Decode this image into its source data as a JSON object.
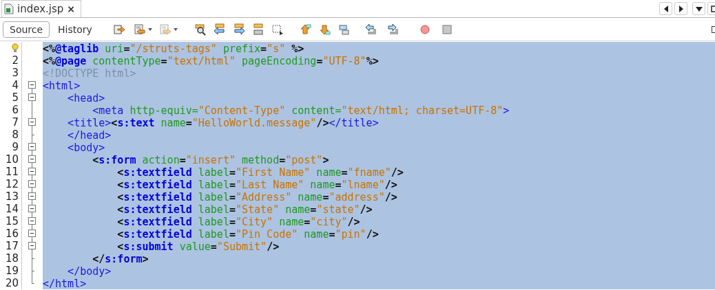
{
  "tab": {
    "title": "index.jsp",
    "close": "×",
    "selected": true
  },
  "view_tabs": [
    {
      "label": "Source",
      "selected": true
    },
    {
      "label": "History",
      "selected": false
    }
  ],
  "editor": {
    "selected": true,
    "lines": [
      {
        "hint": true,
        "kind": "plain",
        "tokens": [
          {
            "t": "<%",
            "kind": "delimiter"
          },
          {
            "t": "@taglib",
            "kind": "keyword"
          },
          {
            "t": " uri",
            "kind": "attribute"
          },
          {
            "t": "=",
            "kind": "delimiter"
          },
          {
            "t": "\"/struts-tags\"",
            "kind": "value"
          },
          {
            "t": " prefix",
            "kind": "attribute"
          },
          {
            "t": "=",
            "kind": "delimiter"
          },
          {
            "t": "\"s\"",
            "kind": "value"
          },
          {
            "t": " %>",
            "kind": "delimiter"
          }
        ]
      },
      {
        "number": "2",
        "hint": false,
        "kind": "plain",
        "tokens": [
          {
            "t": "<%",
            "kind": "delimiter"
          },
          {
            "t": "@page",
            "kind": "keyword"
          },
          {
            "t": " contentType",
            "kind": "attribute"
          },
          {
            "t": "=",
            "kind": "delimiter"
          },
          {
            "t": "\"text/html\"",
            "kind": "value"
          },
          {
            "t": " pageEncoding",
            "kind": "attribute"
          },
          {
            "t": "=",
            "kind": "delimiter"
          },
          {
            "t": "\"UTF-8\"",
            "kind": "value"
          },
          {
            "t": "%>",
            "kind": "delimiter"
          }
        ]
      },
      {
        "number": "3",
        "hint": false,
        "kind": "plain",
        "tokens": [
          {
            "t": "<!DOCTYPE html>",
            "kind": "comment"
          }
        ]
      },
      {
        "number": "4",
        "hint": false,
        "kind": "fold",
        "tokens": [
          {
            "t": "<html>",
            "kind": "tag"
          }
        ]
      },
      {
        "number": "5",
        "hint": false,
        "kind": "fold",
        "tokens": [
          {
            "t": "    <head>",
            "kind": "tag"
          }
        ]
      },
      {
        "number": "6",
        "hint": false,
        "kind": "inner",
        "tokens": [
          {
            "t": "        <meta",
            "kind": "tag"
          },
          {
            "t": " http-equiv=",
            "kind": "attribute"
          },
          {
            "t": "\"Content-Type\"",
            "kind": "value"
          },
          {
            "t": " content=",
            "kind": "attribute"
          },
          {
            "t": "\"text/html; charset=UTF-8\"",
            "kind": "value"
          },
          {
            "t": ">",
            "kind": "tag"
          }
        ]
      },
      {
        "number": "7",
        "hint": false,
        "kind": "fold",
        "tokens": [
          {
            "t": "    <title>",
            "kind": "tag"
          },
          {
            "t": "<",
            "kind": "delimiter"
          },
          {
            "t": "s:text",
            "kind": "keyword"
          },
          {
            "t": " name",
            "kind": "attribute"
          },
          {
            "t": "=",
            "kind": "delimiter"
          },
          {
            "t": "\"HelloWorld.message\"",
            "kind": "value"
          },
          {
            "t": "/>",
            "kind": "delimiter"
          },
          {
            "t": "</title>",
            "kind": "tag"
          }
        ]
      },
      {
        "number": "8",
        "hint": false,
        "kind": "close",
        "tokens": [
          {
            "t": "    </head>",
            "kind": "tag"
          }
        ]
      },
      {
        "number": "9",
        "hint": false,
        "kind": "fold",
        "tokens": [
          {
            "t": "    <body>",
            "kind": "tag"
          }
        ]
      },
      {
        "number": "10",
        "hint": false,
        "kind": "fold",
        "tokens": [
          {
            "t": "        <",
            "kind": "delimiter"
          },
          {
            "t": "s:form",
            "kind": "keyword"
          },
          {
            "t": " action",
            "kind": "attribute"
          },
          {
            "t": "=",
            "kind": "delimiter"
          },
          {
            "t": "\"insert\"",
            "kind": "value"
          },
          {
            "t": " method",
            "kind": "attribute"
          },
          {
            "t": "=",
            "kind": "delimiter"
          },
          {
            "t": "\"post\"",
            "kind": "value"
          },
          {
            "t": ">",
            "kind": "delimiter"
          }
        ]
      },
      {
        "number": "11",
        "hint": false,
        "kind": "fold",
        "tokens": [
          {
            "t": "            <",
            "kind": "delimiter"
          },
          {
            "t": "s:textfield",
            "kind": "keyword"
          },
          {
            "t": " label",
            "kind": "attribute"
          },
          {
            "t": "=",
            "kind": "delimiter"
          },
          {
            "t": "\"First Name\"",
            "kind": "value"
          },
          {
            "t": " name",
            "kind": "attribute"
          },
          {
            "t": "=",
            "kind": "delimiter"
          },
          {
            "t": "\"fname\"",
            "kind": "value"
          },
          {
            "t": "/>",
            "kind": "delimiter"
          }
        ]
      },
      {
        "number": "12",
        "hint": false,
        "kind": "fold",
        "tokens": [
          {
            "t": "            <",
            "kind": "delimiter"
          },
          {
            "t": "s:textfield",
            "kind": "keyword"
          },
          {
            "t": " label",
            "kind": "attribute"
          },
          {
            "t": "=",
            "kind": "delimiter"
          },
          {
            "t": "\"Last Name\"",
            "kind": "value"
          },
          {
            "t": " name",
            "kind": "attribute"
          },
          {
            "t": "=",
            "kind": "delimiter"
          },
          {
            "t": "\"lname\"",
            "kind": "value"
          },
          {
            "t": "/>",
            "kind": "delimiter"
          }
        ]
      },
      {
        "number": "13",
        "hint": false,
        "kind": "fold",
        "tokens": [
          {
            "t": "            <",
            "kind": "delimiter"
          },
          {
            "t": "s:textfield",
            "kind": "keyword"
          },
          {
            "t": " label",
            "kind": "attribute"
          },
          {
            "t": "=",
            "kind": "delimiter"
          },
          {
            "t": "\"Address\"",
            "kind": "value"
          },
          {
            "t": " name",
            "kind": "attribute"
          },
          {
            "t": "=",
            "kind": "delimiter"
          },
          {
            "t": "\"address\"",
            "kind": "value"
          },
          {
            "t": "/>",
            "kind": "delimiter"
          }
        ]
      },
      {
        "number": "14",
        "hint": false,
        "kind": "fold",
        "tokens": [
          {
            "t": "            <",
            "kind": "delimiter"
          },
          {
            "t": "s:textfield",
            "kind": "keyword"
          },
          {
            "t": " label",
            "kind": "attribute"
          },
          {
            "t": "=",
            "kind": "delimiter"
          },
          {
            "t": "\"State\"",
            "kind": "value"
          },
          {
            "t": " name",
            "kind": "attribute"
          },
          {
            "t": "=",
            "kind": "delimiter"
          },
          {
            "t": "\"state\"",
            "kind": "value"
          },
          {
            "t": "/>",
            "kind": "delimiter"
          }
        ]
      },
      {
        "number": "15",
        "hint": false,
        "kind": "fold",
        "tokens": [
          {
            "t": "            <",
            "kind": "delimiter"
          },
          {
            "t": "s:textfield",
            "kind": "keyword"
          },
          {
            "t": " label",
            "kind": "attribute"
          },
          {
            "t": "=",
            "kind": "delimiter"
          },
          {
            "t": "\"City\"",
            "kind": "value"
          },
          {
            "t": " name",
            "kind": "attribute"
          },
          {
            "t": "=",
            "kind": "delimiter"
          },
          {
            "t": "\"city\"",
            "kind": "value"
          },
          {
            "t": "/>",
            "kind": "delimiter"
          }
        ]
      },
      {
        "number": "16",
        "hint": false,
        "kind": "fold",
        "tokens": [
          {
            "t": "            <",
            "kind": "delimiter"
          },
          {
            "t": "s:textfield",
            "kind": "keyword"
          },
          {
            "t": " label",
            "kind": "attribute"
          },
          {
            "t": "=",
            "kind": "delimiter"
          },
          {
            "t": "\"Pin Code\"",
            "kind": "value"
          },
          {
            "t": " name",
            "kind": "attribute"
          },
          {
            "t": "=",
            "kind": "delimiter"
          },
          {
            "t": "\"pin\"",
            "kind": "value"
          },
          {
            "t": "/>",
            "kind": "delimiter"
          }
        ]
      },
      {
        "number": "17",
        "hint": false,
        "kind": "fold",
        "tokens": [
          {
            "t": "            <",
            "kind": "delimiter"
          },
          {
            "t": "s:submit",
            "kind": "keyword"
          },
          {
            "t": " value",
            "kind": "attribute"
          },
          {
            "t": "=",
            "kind": "delimiter"
          },
          {
            "t": "\"Submit\"",
            "kind": "value"
          },
          {
            "t": "/>",
            "kind": "delimiter"
          }
        ]
      },
      {
        "number": "18",
        "hint": false,
        "kind": "close",
        "tokens": [
          {
            "t": "        </",
            "kind": "delimiter"
          },
          {
            "t": "s:form",
            "kind": "keyword"
          },
          {
            "t": ">",
            "kind": "delimiter"
          }
        ]
      },
      {
        "number": "19",
        "hint": false,
        "kind": "close",
        "tokens": [
          {
            "t": "    </body>",
            "kind": "tag"
          }
        ]
      },
      {
        "number": "20",
        "hint": false,
        "kind": "end",
        "tokens": [
          {
            "t": "</html>",
            "kind": "tag"
          }
        ]
      }
    ]
  }
}
